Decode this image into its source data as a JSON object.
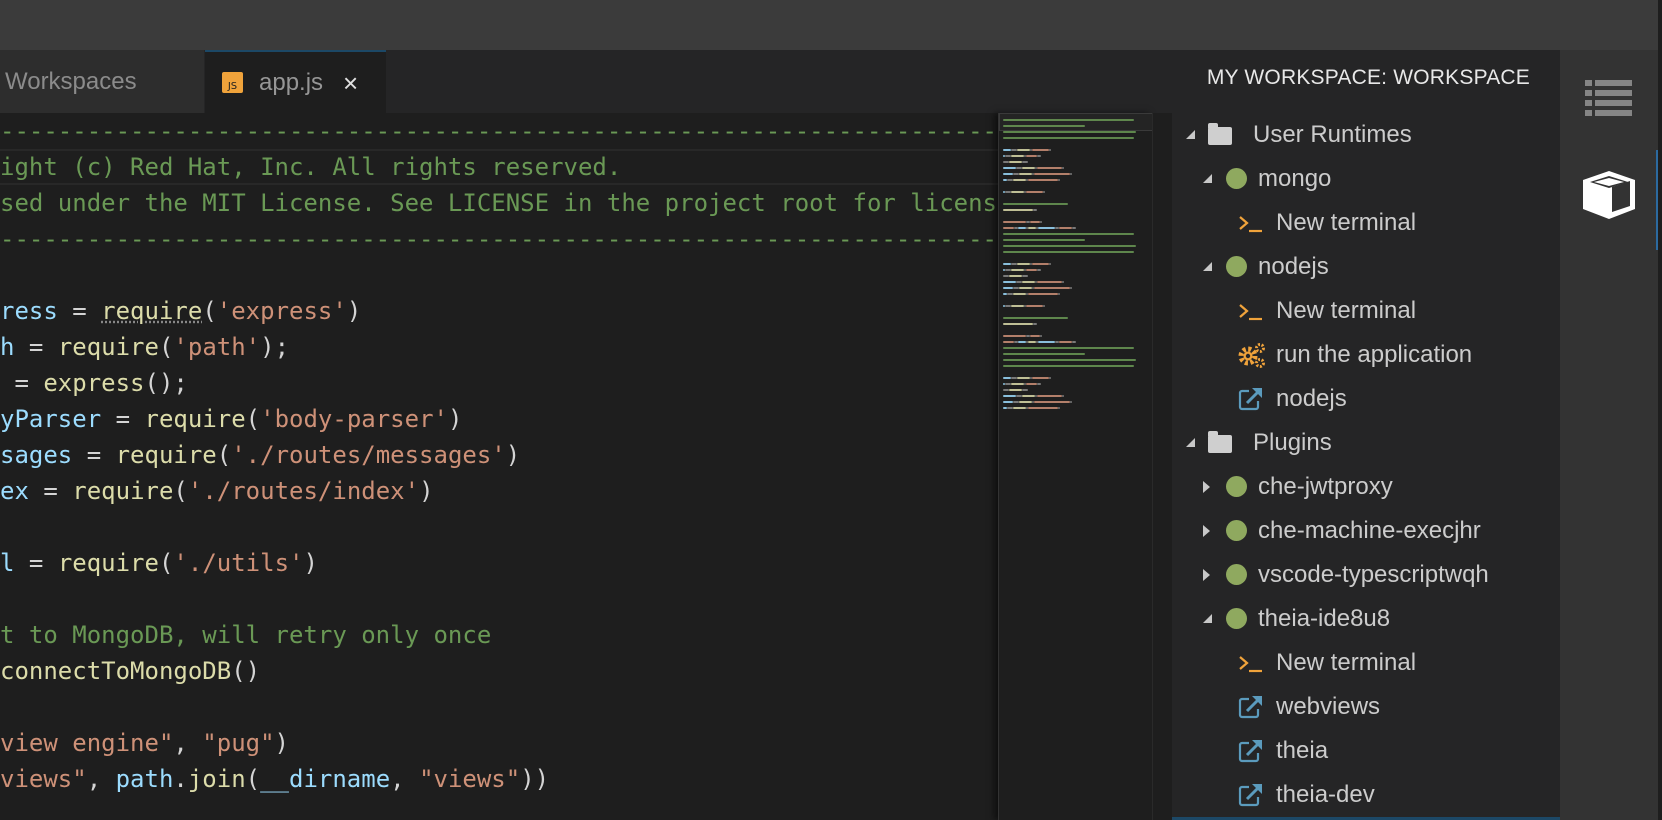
{
  "tabs": [
    {
      "label": "Workspaces",
      "active": false
    },
    {
      "label": "app.js",
      "active": true,
      "icon": "js-file-icon",
      "icon_text": "JS",
      "close_icon": "close-icon",
      "close_glyph": "×"
    }
  ],
  "editor": {
    "lines": [
      [
        {
          "t": "c-com",
          "v": "---------------------------------------------------------------------"
        }
      ],
      [
        {
          "t": "c-com",
          "v": "ight (c) Red Hat, Inc. All rights reserved."
        }
      ],
      [
        {
          "t": "c-com",
          "v": "sed under the MIT License. See LICENSE in the project root for license"
        }
      ],
      [
        {
          "t": "c-com",
          "v": "---------------------------------------------------------------------"
        }
      ],
      [],
      [
        {
          "t": "c-var",
          "v": "ress"
        },
        {
          "t": "c-pun",
          "v": " = "
        },
        {
          "t": "c-fn squig",
          "v": "require"
        },
        {
          "t": "c-pun",
          "v": "("
        },
        {
          "t": "c-str",
          "v": "'express'"
        },
        {
          "t": "c-pun",
          "v": ")"
        }
      ],
      [
        {
          "t": "c-var",
          "v": "h"
        },
        {
          "t": "c-pun",
          "v": " = "
        },
        {
          "t": "c-fn",
          "v": "require"
        },
        {
          "t": "c-pun",
          "v": "("
        },
        {
          "t": "c-str",
          "v": "'path'"
        },
        {
          "t": "c-pun",
          "v": ");"
        }
      ],
      [
        {
          "t": "c-pun",
          "v": " = "
        },
        {
          "t": "c-fn",
          "v": "express"
        },
        {
          "t": "c-pun",
          "v": "();"
        }
      ],
      [
        {
          "t": "c-var",
          "v": "yParser"
        },
        {
          "t": "c-pun",
          "v": " = "
        },
        {
          "t": "c-fn",
          "v": "require"
        },
        {
          "t": "c-pun",
          "v": "("
        },
        {
          "t": "c-str",
          "v": "'body-parser'"
        },
        {
          "t": "c-pun",
          "v": ")"
        }
      ],
      [
        {
          "t": "c-var",
          "v": "sages"
        },
        {
          "t": "c-pun",
          "v": " = "
        },
        {
          "t": "c-fn",
          "v": "require"
        },
        {
          "t": "c-pun",
          "v": "("
        },
        {
          "t": "c-str",
          "v": "'./routes/messages'"
        },
        {
          "t": "c-pun",
          "v": ")"
        }
      ],
      [
        {
          "t": "c-var",
          "v": "ex"
        },
        {
          "t": "c-pun",
          "v": " = "
        },
        {
          "t": "c-fn",
          "v": "require"
        },
        {
          "t": "c-pun",
          "v": "("
        },
        {
          "t": "c-str",
          "v": "'./routes/index'"
        },
        {
          "t": "c-pun",
          "v": ")"
        }
      ],
      [],
      [
        {
          "t": "c-var",
          "v": "l"
        },
        {
          "t": "c-pun",
          "v": " = "
        },
        {
          "t": "c-fn",
          "v": "require"
        },
        {
          "t": "c-pun",
          "v": "("
        },
        {
          "t": "c-str",
          "v": "'./utils'"
        },
        {
          "t": "c-pun",
          "v": ")"
        }
      ],
      [],
      [
        {
          "t": "c-com",
          "v": "t to MongoDB, will retry only once"
        }
      ],
      [
        {
          "t": "c-fn",
          "v": "connectToMongoDB"
        },
        {
          "t": "c-pun",
          "v": "()"
        }
      ],
      [],
      [
        {
          "t": "c-str",
          "v": "view engine\""
        },
        {
          "t": "c-pun",
          "v": ", "
        },
        {
          "t": "c-str",
          "v": "\"pug\""
        },
        {
          "t": "c-pun",
          "v": ")"
        }
      ],
      [
        {
          "t": "c-str",
          "v": "views\""
        },
        {
          "t": "c-pun",
          "v": ", "
        },
        {
          "t": "c-var",
          "v": "path"
        },
        {
          "t": "c-pun",
          "v": "."
        },
        {
          "t": "c-fn",
          "v": "join"
        },
        {
          "t": "c-pun",
          "v": "("
        },
        {
          "t": "c-var",
          "v": "__dirname"
        },
        {
          "t": "c-pun",
          "v": ", "
        },
        {
          "t": "c-str",
          "v": "\"views\""
        },
        {
          "t": "c-pun",
          "v": "))"
        }
      ]
    ]
  },
  "workspace_panel": {
    "title": "MY WORKSPACE: WORKSPACE",
    "tree": [
      {
        "level": 0,
        "twisty": "open",
        "icon": "folder-icon",
        "label": "User Runtimes"
      },
      {
        "level": 1,
        "twisty": "open",
        "icon": "status-running-icon",
        "label": "mongo"
      },
      {
        "level": 2,
        "icon": "terminal-icon",
        "label": "New terminal"
      },
      {
        "level": 1,
        "twisty": "open",
        "icon": "status-running-icon",
        "label": "nodejs"
      },
      {
        "level": 2,
        "icon": "terminal-icon",
        "label": "New terminal"
      },
      {
        "level": 2,
        "icon": "gears-icon",
        "label": "run the application"
      },
      {
        "level": 2,
        "icon": "external-link-icon",
        "label": "nodejs"
      },
      {
        "level": 0,
        "twisty": "open",
        "icon": "folder-icon",
        "label": "Plugins"
      },
      {
        "level": 1,
        "twisty": "closed",
        "icon": "status-running-icon",
        "label": "che-jwtproxy"
      },
      {
        "level": 1,
        "twisty": "closed",
        "icon": "status-running-icon",
        "label": "che-machine-execjhr"
      },
      {
        "level": 1,
        "twisty": "closed",
        "icon": "status-running-icon",
        "label": "vscode-typescriptwqh"
      },
      {
        "level": 1,
        "twisty": "open",
        "icon": "status-running-icon",
        "label": "theia-ide8u8"
      },
      {
        "level": 2,
        "icon": "terminal-icon",
        "label": "New terminal"
      },
      {
        "level": 2,
        "icon": "external-link-icon",
        "label": "webviews"
      },
      {
        "level": 2,
        "icon": "external-link-icon",
        "label": "theia"
      },
      {
        "level": 2,
        "icon": "external-link-icon",
        "label": "theia-dev"
      }
    ]
  },
  "activity_bar": [
    {
      "name": "outline-list-icon",
      "active": false
    },
    {
      "name": "workspace-cube-icon",
      "active": true
    }
  ],
  "colors": {
    "running_status": "#8fa95f",
    "terminal_icon": "#f0a33b",
    "link_icon": "#5b9bbd",
    "accent": "#1c4866"
  }
}
